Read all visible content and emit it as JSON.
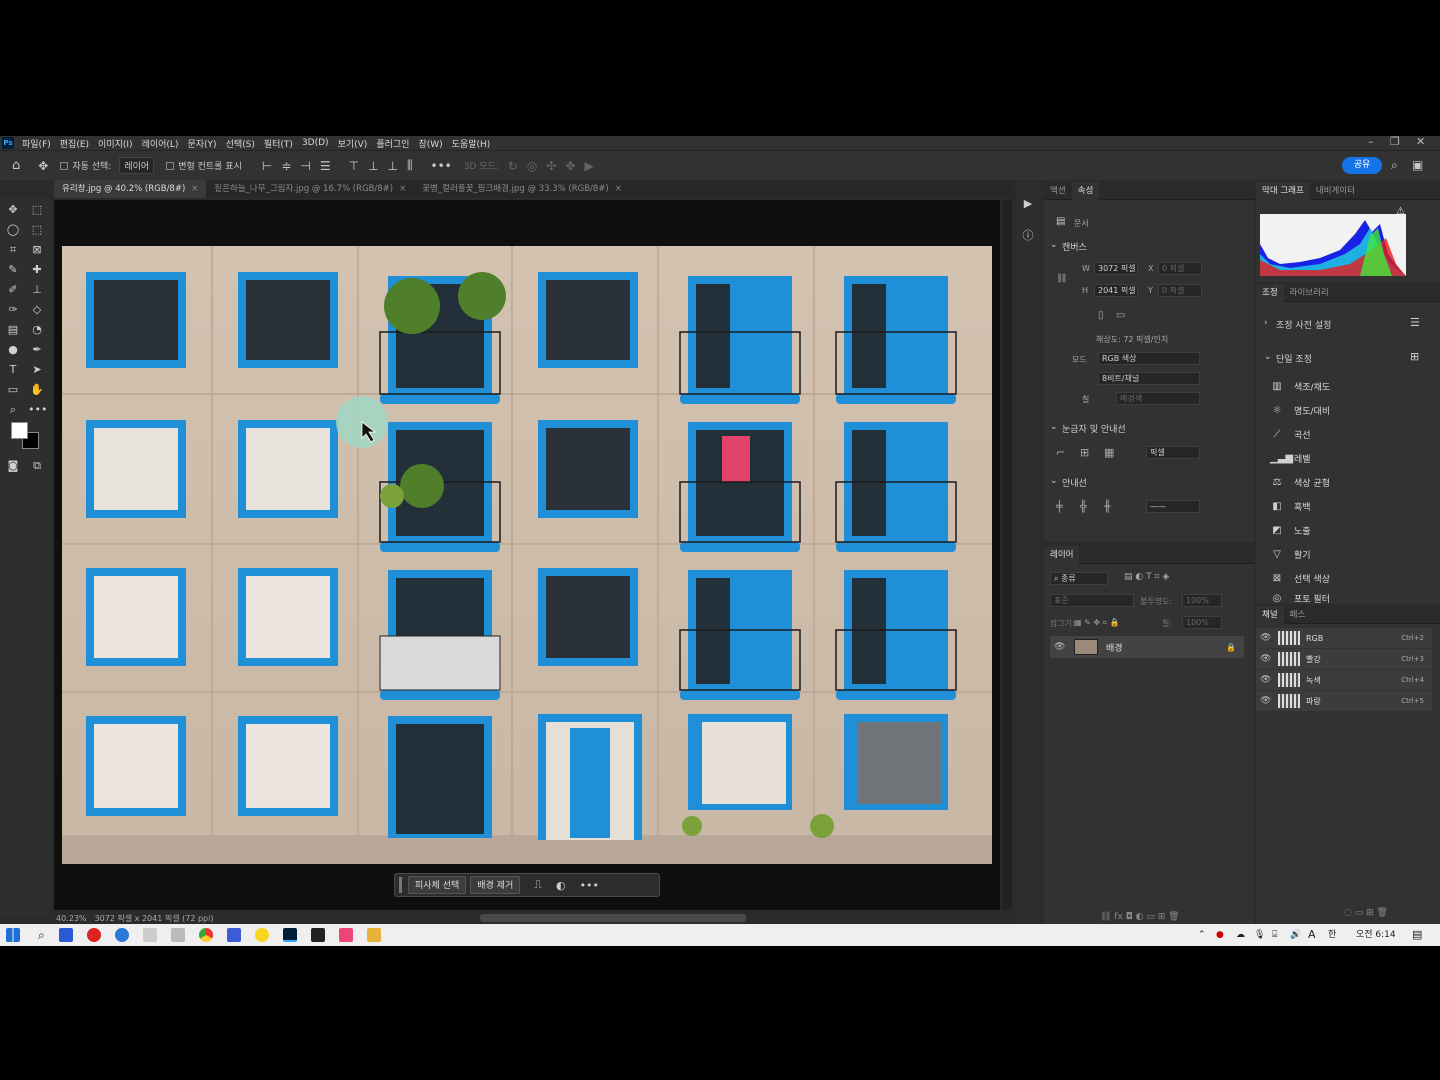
{
  "menu": {
    "logo": "Ps",
    "items": [
      "파일(F)",
      "편집(E)",
      "이미지(I)",
      "레이어(L)",
      "문자(Y)",
      "선택(S)",
      "필터(T)",
      "3D(D)",
      "보기(V)",
      "플러그인",
      "창(W)",
      "도움말(H)"
    ]
  },
  "options": {
    "auto_select_label": "자동 선택:",
    "auto_select_value": "레이어",
    "transform_label": "변형 컨트롤 표시",
    "mode_3d": "3D 모드:",
    "share": "공유"
  },
  "tabs": [
    {
      "label": "유리창.jpg @ 40.2% (RGB/8#)",
      "active": true
    },
    {
      "label": "짙은하늘_나무_그림자.jpg @ 16.7% (RGB/8#)",
      "active": false
    },
    {
      "label": "꽃병_컬러풀꽃_핑크배경.jpg @ 33.3% (RGB/8#)",
      "active": false
    }
  ],
  "contextbar": {
    "select_subject": "피사체 선택",
    "remove_bg": "배경 제거"
  },
  "status": {
    "zoom": "40.23%",
    "info": "3072 픽셀 x 2041 픽셀 (72 ppi)"
  },
  "properties": {
    "tabs": [
      "액션",
      "속성"
    ],
    "doc_label": "문서",
    "canvas_title": "캔버스",
    "w_label": "W",
    "w_value": "3072 픽셀",
    "h_label": "H",
    "h_value": "2041 픽셀",
    "x_label": "X",
    "x_value": "0 픽셀",
    "y_label": "Y",
    "y_value": "0 픽셀",
    "resolution": "해상도: 72 픽셀/인치",
    "mode_label": "모드",
    "mode_value": "RGB 색상",
    "depth_value": "8비트/채널",
    "fill_label": "칠",
    "fill_value": "배경색",
    "rulers_title": "눈금자 및 안내선",
    "rulers_unit": "픽셀",
    "guides_title": "안내선"
  },
  "layers": {
    "tab": "레이어",
    "kind": "종류",
    "blend": "표준",
    "opacity_label": "불투명도:",
    "opacity_value": "100%",
    "lock_label": "잠그기:",
    "fill_label": "칠:",
    "fill_value": "100%",
    "layer_name": "배경"
  },
  "histogram": {
    "tabs": [
      "막대 그래프",
      "내비게이터"
    ]
  },
  "adjustments": {
    "tabs": [
      "조정",
      "라이브러리"
    ],
    "presets": "조정 사전 설정",
    "single": "단일 조정",
    "items": [
      "색조/채도",
      "명도/대비",
      "곡선",
      "레벨",
      "색상 균형",
      "흑백",
      "노출",
      "활기",
      "선택 색상",
      "포토 필터"
    ]
  },
  "channels": {
    "tabs": [
      "채널",
      "패스"
    ],
    "rows": [
      {
        "name": "RGB",
        "shortcut": "Ctrl+2"
      },
      {
        "name": "빨강",
        "shortcut": "Ctrl+3"
      },
      {
        "name": "녹색",
        "shortcut": "Ctrl+4"
      },
      {
        "name": "파랑",
        "shortcut": "Ctrl+5"
      }
    ]
  },
  "taskbar": {
    "time": "오전 6:14",
    "ime": "한",
    "lang": "A"
  },
  "colors": {
    "accent": "#1473e6",
    "window_blue": "#1f8fd8",
    "wall": "#d8c6b4"
  }
}
